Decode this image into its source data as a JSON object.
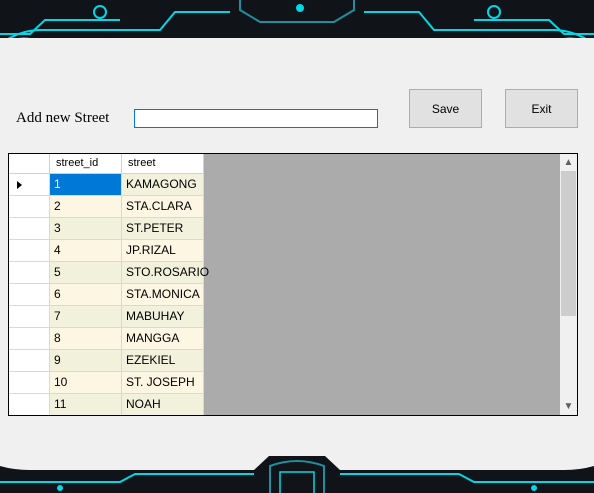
{
  "form": {
    "label": "Add new Street",
    "input_value": ""
  },
  "buttons": {
    "save": "Save",
    "exit": "Exit"
  },
  "grid": {
    "columns": [
      "street_id",
      "street"
    ],
    "selected_row": 0,
    "rows": [
      {
        "id": "1",
        "street": "KAMAGONG"
      },
      {
        "id": "2",
        "street": "STA.CLARA"
      },
      {
        "id": "3",
        "street": "ST.PETER"
      },
      {
        "id": "4",
        "street": "JP.RIZAL"
      },
      {
        "id": "5",
        "street": "STO.ROSARIO"
      },
      {
        "id": "6",
        "street": "STA.MONICA"
      },
      {
        "id": "7",
        "street": "MABUHAY"
      },
      {
        "id": "8",
        "street": "MANGGA"
      },
      {
        "id": "9",
        "street": "EZEKIEL"
      },
      {
        "id": "10",
        "street": "ST. JOSEPH"
      },
      {
        "id": "11",
        "street": "NOAH"
      }
    ]
  },
  "colors": {
    "accent": "#0078d7",
    "banner": "#101418",
    "circuit": "#00d8e8"
  }
}
